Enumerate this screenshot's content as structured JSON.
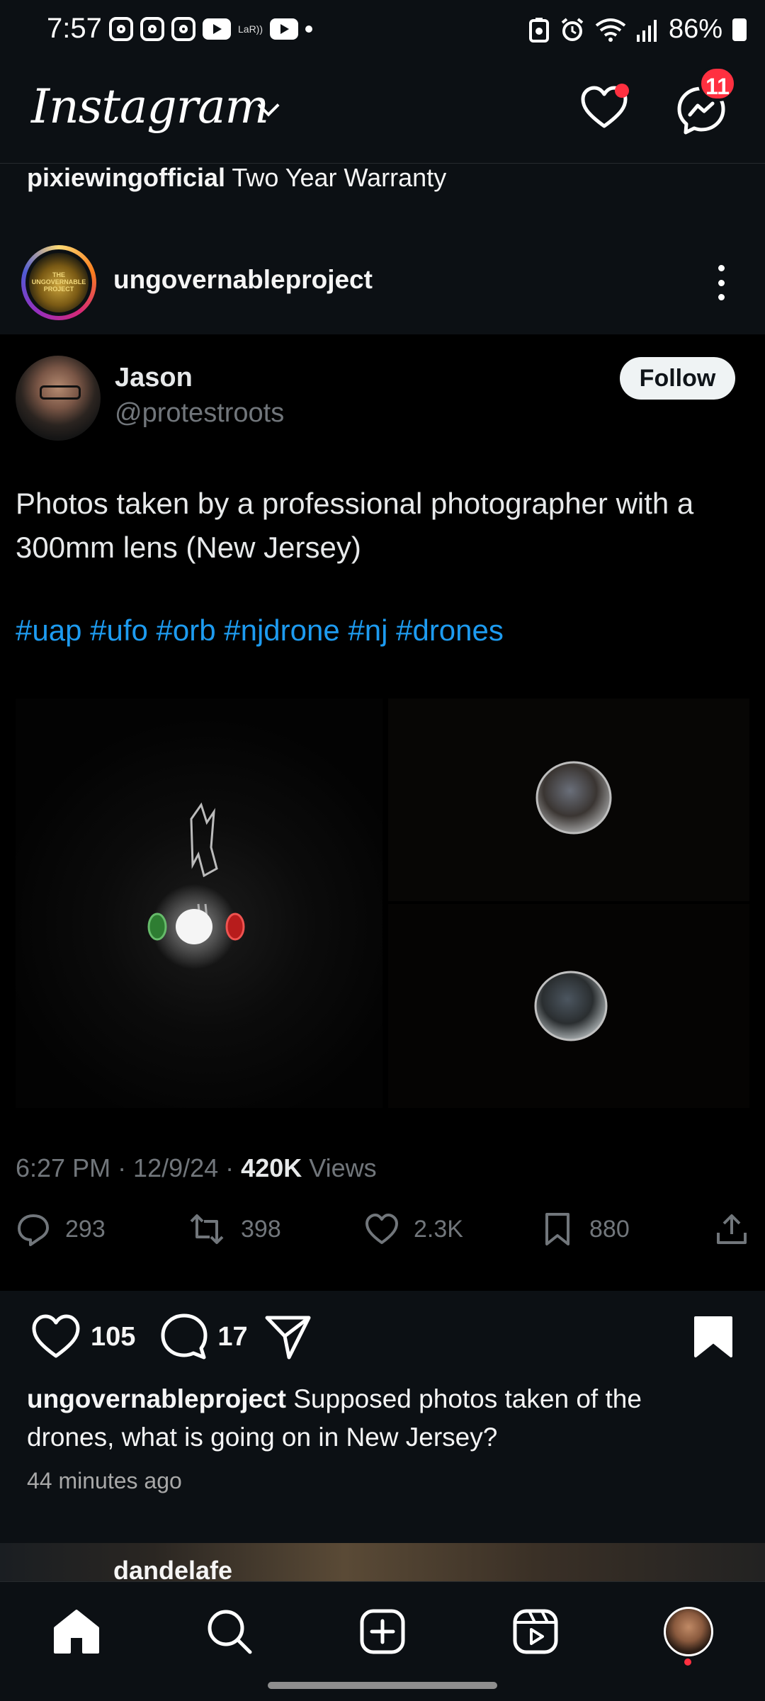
{
  "status_bar": {
    "time": "7:57",
    "lte_label": "LaR))",
    "battery": "86%"
  },
  "header": {
    "logo": "Instagram",
    "messages_badge": "11"
  },
  "previous_post": {
    "username": "pixiewingofficial",
    "caption": "Two Year Warranty"
  },
  "post": {
    "username": "ungovernableproject",
    "avatar_text": "THE UNGOVERNABLE PROJECT",
    "tweet": {
      "name": "Jason",
      "handle": "@protestroots",
      "follow_label": "Follow",
      "text": "Photos taken by a professional photographer with a 300mm lens (New Jersey)",
      "hashtags": "#uap #ufo #orb #njdrone #nj #drones",
      "time": "6:27 PM · 12/9/24 · ",
      "views_count": "420K",
      "views_label": " Views",
      "replies": "293",
      "reposts": "398",
      "likes": "2.3K",
      "bookmarks": "880"
    },
    "like_count": "105",
    "comment_count": "17",
    "caption_user": "ungovernableproject",
    "caption_text": " Supposed photos taken of the drones, what is going on in New Jersey?",
    "time_ago": "44 minutes ago"
  },
  "next_post": {
    "username": "dandelafe"
  },
  "nav": {
    "items": [
      "home-icon",
      "search-icon",
      "create-icon",
      "reels-icon",
      "profile-avatar"
    ]
  }
}
